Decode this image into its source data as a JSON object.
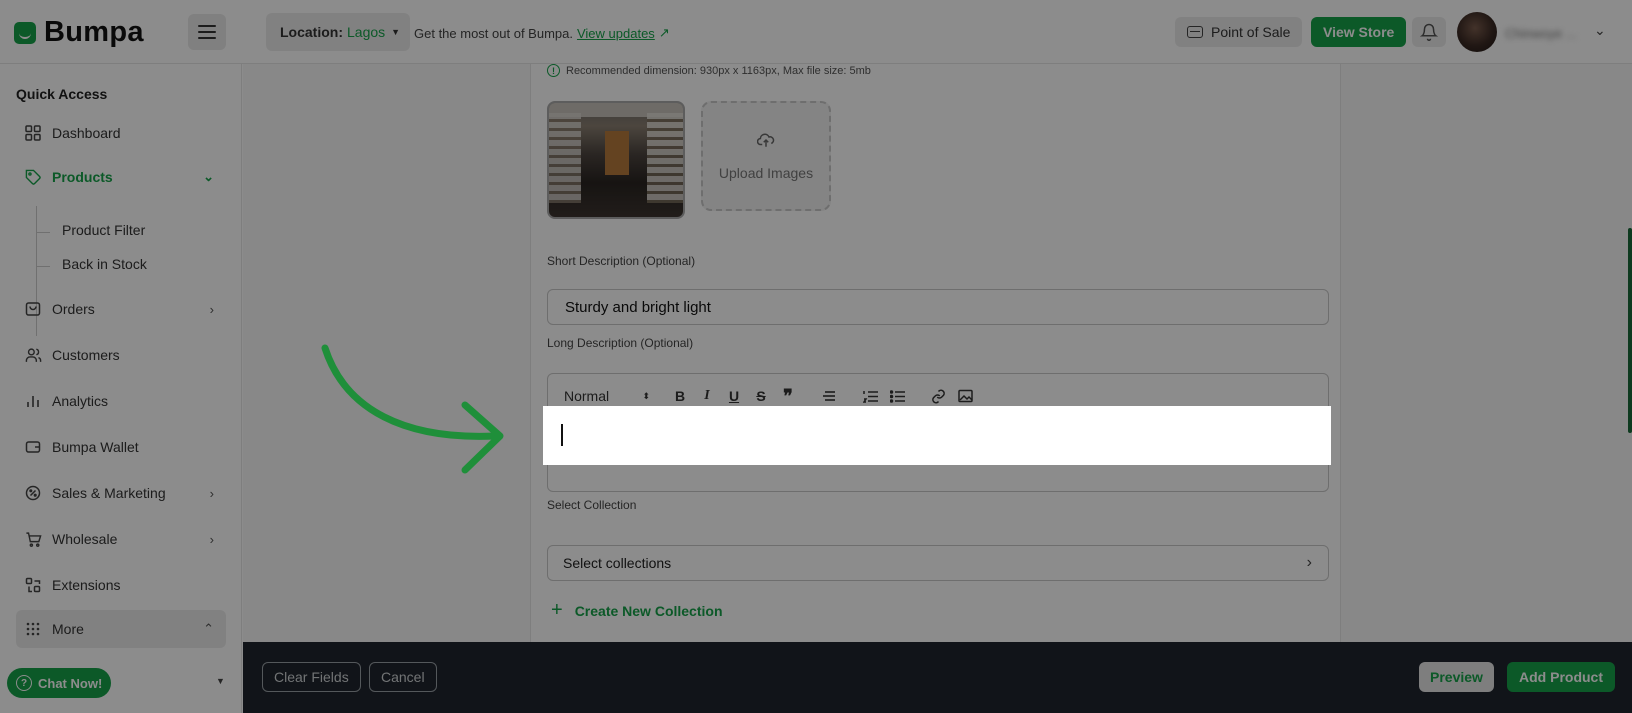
{
  "header": {
    "logo_text": "Bumpa",
    "location_label": "Location:",
    "location_value": "Lagos",
    "promo_text": "Get the most out of Bumpa.",
    "promo_link": "View updates",
    "point_of_sale": "Point of Sale",
    "view_store": "View Store",
    "user_name": "Chinwoye ..."
  },
  "sidebar": {
    "section_title": "Quick Access",
    "items": {
      "dashboard": "Dashboard",
      "products": "Products",
      "product_filter": "Product Filter",
      "back_in_stock": "Back in Stock",
      "orders": "Orders",
      "customers": "Customers",
      "analytics": "Analytics",
      "wallet": "Bumpa Wallet",
      "sales_marketing": "Sales & Marketing",
      "wholesale": "Wholesale",
      "extensions": "Extensions",
      "more": "More"
    },
    "chat_button": "Chat Now!"
  },
  "form": {
    "image_hint": "Recommended dimension: 930px x 1163px, Max file size: 5mb",
    "upload_images": "Upload Images",
    "short_description_label": "Short Description (Optional)",
    "short_description_value": "Sturdy and bright light",
    "long_description_label": "Long Description (Optional)",
    "editor_format": "Normal",
    "select_collection_label": "Select Collection",
    "select_collection_placeholder": "Select collections",
    "create_collection": "Create New Collection"
  },
  "footer": {
    "clear_fields": "Clear Fields",
    "cancel": "Cancel",
    "preview": "Preview",
    "add_product": "Add Product"
  },
  "colors": {
    "brand": "#16a34a",
    "footer_bg": "#20262e",
    "overlay": "rgba(0,0,0,0.45)"
  }
}
